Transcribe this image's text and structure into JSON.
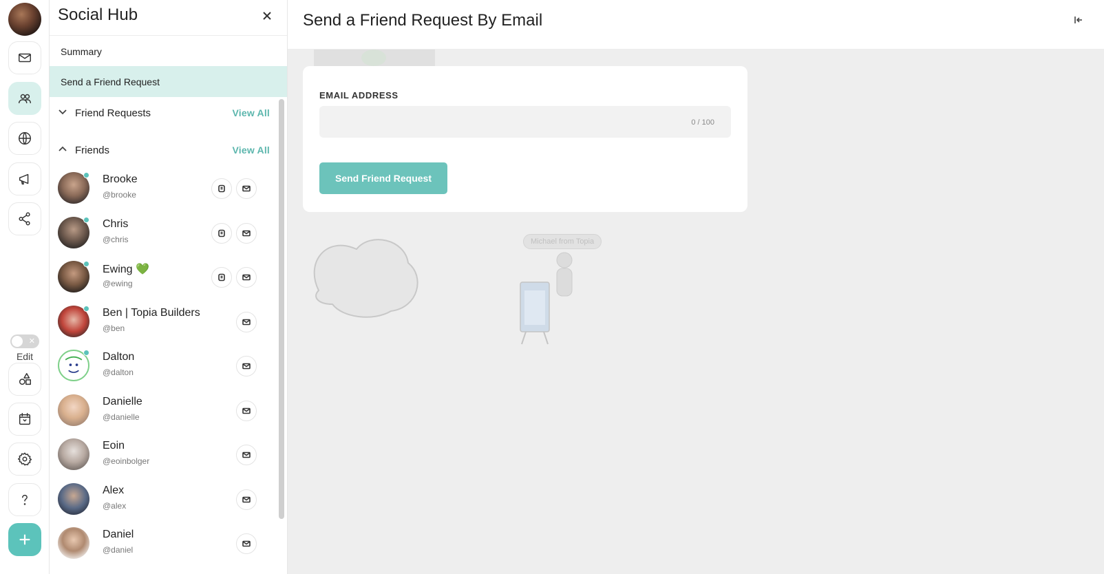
{
  "rail": {
    "icons": [
      "mail-icon",
      "people-icon",
      "globe-icon",
      "megaphone-icon",
      "share-icon",
      "shapes-icon",
      "calendar-icon",
      "gear-icon",
      "question-icon",
      "plus-icon"
    ],
    "edit_label": "Edit",
    "accent_color": "#5cc3bb"
  },
  "panel": {
    "title": "Social Hub",
    "nav": [
      {
        "label": "Summary"
      },
      {
        "label": "Send a Friend Request"
      }
    ],
    "sections": [
      {
        "title": "Friend Requests",
        "view_all": "View All",
        "expanded": false
      },
      {
        "title": "Friends",
        "view_all": "View All",
        "expanded": true
      }
    ],
    "friends": [
      {
        "name": "Brooke",
        "handle": "@brooke",
        "online": true,
        "chat": true
      },
      {
        "name": "Chris",
        "handle": "@chris",
        "online": true,
        "chat": true
      },
      {
        "name": "Ewing 💚",
        "handle": "@ewing",
        "online": true,
        "chat": true
      },
      {
        "name": "Ben | Topia Builders",
        "handle": "@ben",
        "online": true,
        "chat": false
      },
      {
        "name": "Dalton",
        "handle": "@dalton",
        "online": true,
        "chat": false
      },
      {
        "name": "Danielle",
        "handle": "@danielle",
        "online": false,
        "chat": false
      },
      {
        "name": "Eoin",
        "handle": "@eoinbolger",
        "online": false,
        "chat": false
      },
      {
        "name": "Alex",
        "handle": "@alex",
        "online": false,
        "chat": false
      },
      {
        "name": "Daniel",
        "handle": "@daniel",
        "online": false,
        "chat": false
      }
    ]
  },
  "main": {
    "title": "Send a Friend Request By Email",
    "form": {
      "field_label": "EMAIL ADDRESS",
      "value": "",
      "counter": "0 / 100",
      "button": "Send Friend Request"
    },
    "scene_label": "Michael from Topia"
  }
}
